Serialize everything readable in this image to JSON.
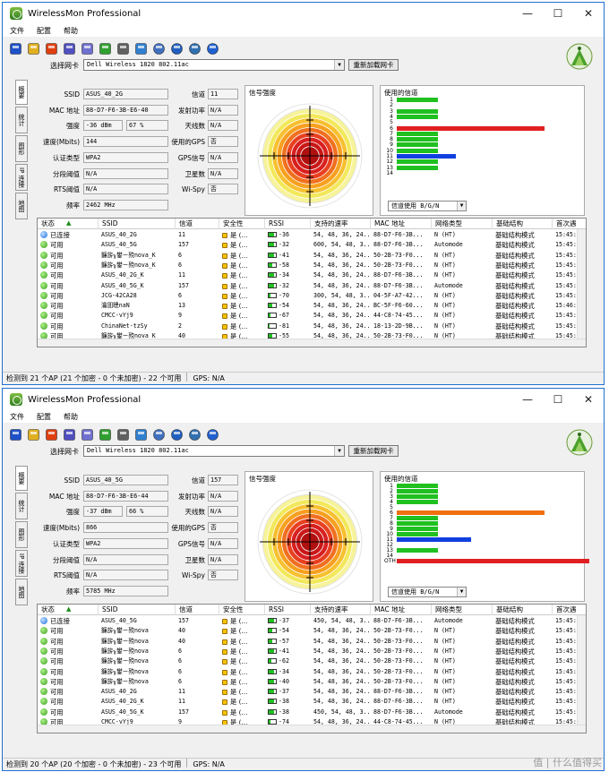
{
  "windows": [
    {
      "title": "WirelessMon Professional",
      "menu": [
        "文件",
        "配置",
        "帮助"
      ],
      "adapter_label": "选择网卡",
      "adapter_value": "Dell Wireless 1820 802.11ac",
      "reload_label": "重新加载网卡",
      "tabs": [
        "概要",
        "统计",
        "图形",
        "IP 连接",
        "地图"
      ],
      "info_left": [
        {
          "label": "SSID",
          "value": "ASUS_40_2G"
        },
        {
          "label": "MAC 地址",
          "value": "88-D7-F6-3B-E6-40"
        },
        {
          "label": "强度",
          "value": "-36  dBm",
          "value2": "67 %"
        },
        {
          "label": "速度(Mbits)",
          "value": "144"
        },
        {
          "label": "认证类型",
          "value": "WPA2"
        },
        {
          "label": "分段阈值",
          "value": "N/A"
        },
        {
          "label": "RTS阈值",
          "value": "N/A"
        },
        {
          "label": "频率",
          "value": "2462 MHz"
        }
      ],
      "info_right": [
        {
          "label": "信道",
          "value": "11"
        },
        {
          "label": "发射功率",
          "value": "N/A"
        },
        {
          "label": "天线数",
          "value": "N/A"
        },
        {
          "label": "使用的GPS",
          "value": "否"
        },
        {
          "label": "GPS信号",
          "value": "N/A"
        },
        {
          "label": "卫星数",
          "value": "N/A"
        },
        {
          "label": "Wi-Spy",
          "value": "否"
        }
      ],
      "signal_title": "信号强度",
      "channel_title": "使用的信道",
      "channels": [
        {
          "ch": "1",
          "level": 0.28,
          "color": "#20c020"
        },
        {
          "ch": "2",
          "level": 0.0,
          "color": "#20c020"
        },
        {
          "ch": "3",
          "level": 0.28,
          "color": "#20c020"
        },
        {
          "ch": "4",
          "level": 0.28,
          "color": "#20c020"
        },
        {
          "ch": "5",
          "level": 0.0,
          "color": "#20c020"
        },
        {
          "ch": "6",
          "level": 1.0,
          "color": "#e02020"
        },
        {
          "ch": "7",
          "level": 0.28,
          "color": "#20c020"
        },
        {
          "ch": "8",
          "level": 0.28,
          "color": "#20c020"
        },
        {
          "ch": "9",
          "level": 0.28,
          "color": "#20c020"
        },
        {
          "ch": "10",
          "level": 0.28,
          "color": "#20c020"
        },
        {
          "ch": "11",
          "level": 0.4,
          "color": "#1040e0"
        },
        {
          "ch": "12",
          "level": 0.28,
          "color": "#20c020"
        },
        {
          "ch": "13",
          "level": 0.28,
          "color": "#20c020"
        },
        {
          "ch": "14",
          "level": 0.0,
          "color": "#20c020"
        }
      ],
      "channel_select": "信道使用 B/G/N",
      "columns": [
        "状态",
        "SSID",
        "信道",
        "安全性",
        "RSSI",
        "支持的速率",
        "MAC 地址",
        "网络类型",
        "基础结构",
        "首次遇"
      ],
      "rows": [
        {
          "status": "已连接",
          "ssid": "ASUS_40_2G",
          "ch": "11",
          "sec": "是 (...",
          "rssi": "-36",
          "bar": 0.8,
          "rates": "54, 48, 36, 24...",
          "mac": "88-D7-F6-3B...",
          "net": "N (HT)",
          "infra": "基础结构模式",
          "first": "15:45:"
        },
        {
          "status": "可用",
          "ssid": "ASUS_40_5G",
          "ch": "157",
          "sec": "是 (...",
          "rssi": "-32",
          "bar": 0.8,
          "rates": "600, 54, 48, 3...",
          "mac": "88-D7-F6-3B...",
          "net": "Automode",
          "infra": "基础结构模式",
          "first": "15:45:"
        },
        {
          "status": "可用",
          "ssid": "鐮旂┒鐢ㄧ殑nova_K",
          "ch": "6",
          "sec": "是 (...",
          "rssi": "-41",
          "bar": 0.7,
          "rates": "54, 48, 36, 24...",
          "mac": "50-2B-73-F0...",
          "net": "N (HT)",
          "infra": "基础结构模式",
          "first": "15:45:"
        },
        {
          "status": "可用",
          "ssid": "鐮旂┒鐢ㄧ殑nova_K",
          "ch": "6",
          "sec": "是 (...",
          "rssi": "-58",
          "bar": 0.45,
          "rates": "54, 48, 36, 24...",
          "mac": "50-2B-73-F0...",
          "net": "N (HT)",
          "infra": "基础结构模式",
          "first": "15:45:"
        },
        {
          "status": "可用",
          "ssid": "ASUS_40_2G_K",
          "ch": "11",
          "sec": "是 (...",
          "rssi": "-34",
          "bar": 0.8,
          "rates": "54, 48, 36, 24...",
          "mac": "88-D7-F6-3B...",
          "net": "N (HT)",
          "infra": "基础结构模式",
          "first": "15:45:"
        },
        {
          "status": "可用",
          "ssid": "ASUS_40_5G_K",
          "ch": "157",
          "sec": "是 (...",
          "rssi": "-32",
          "bar": 0.8,
          "rates": "54, 48, 36, 24...",
          "mac": "88-D7-F6-3B...",
          "net": "Automode",
          "infra": "基础结构模式",
          "first": "15:45:"
        },
        {
          "status": "可用",
          "ssid": "JCG-42CA28",
          "ch": "6",
          "sec": "是 (...",
          "rssi": "-70",
          "bar": 0.2,
          "rates": "300, 54, 48, 3...",
          "mac": "04-5F-A7-42...",
          "net": "N (HT)",
          "infra": "基础结构模式",
          "first": "15:45:"
        },
        {
          "status": "可用",
          "ssid": "瀹囬瞣naN",
          "ch": "13",
          "sec": "是 (...",
          "rssi": "-54",
          "bar": 0.55,
          "rates": "54, 48, 36, 24...",
          "mac": "BC-5F-F6-60...",
          "net": "N (HT)",
          "infra": "基础结构模式",
          "first": "15:46:"
        },
        {
          "status": "可用",
          "ssid": "CMCC-vYj9",
          "ch": "9",
          "sec": "是 (...",
          "rssi": "-67",
          "bar": 0.3,
          "rates": "54, 48, 36, 24...",
          "mac": "44-C8-74-45...",
          "net": "N (HT)",
          "infra": "基础结构模式",
          "first": "15:45:"
        },
        {
          "status": "可用",
          "ssid": "ChinaNet-tzSy",
          "ch": "2",
          "sec": "是 (...",
          "rssi": "-81",
          "bar": 0.1,
          "rates": "54, 48, 36, 24...",
          "mac": "18-13-2D-9B...",
          "net": "N (HT)",
          "infra": "基础结构模式",
          "first": "15:45:"
        },
        {
          "status": "可用",
          "ssid": "鐮旂┒鐢ㄧ殑nova_K",
          "ch": "40",
          "sec": "是 (...",
          "rssi": "-55",
          "bar": 0.55,
          "rates": "54, 48, 36, 24...",
          "mac": "50-2B-73-F0...",
          "net": "N (HT)",
          "infra": "基础结构模式",
          "first": "15:45:"
        }
      ],
      "status": {
        "detected": "检测到 21 个AP (21 个加密 - 0 个未加密) - 22 个可用",
        "gps": "GPS: N/A"
      }
    },
    {
      "title": "WirelessMon Professional",
      "menu": [
        "文件",
        "配置",
        "帮助"
      ],
      "adapter_label": "选择网卡",
      "adapter_value": "Dell Wireless 1820 802.11ac",
      "reload_label": "重新加载网卡",
      "tabs": [
        "概要",
        "统计",
        "图形",
        "IP 连接",
        "地图"
      ],
      "info_left": [
        {
          "label": "SSID",
          "value": "ASUS_40_5G"
        },
        {
          "label": "MAC 地址",
          "value": "88-D7-F6-3B-E6-44"
        },
        {
          "label": "强度",
          "value": "-37  dBm",
          "value2": "66 %"
        },
        {
          "label": "速度(Mbits)",
          "value": "866"
        },
        {
          "label": "认证类型",
          "value": "WPA2"
        },
        {
          "label": "分段阈值",
          "value": "N/A"
        },
        {
          "label": "RTS阈值",
          "value": "N/A"
        },
        {
          "label": "频率",
          "value": "5785 MHz"
        }
      ],
      "info_right": [
        {
          "label": "信道",
          "value": "157"
        },
        {
          "label": "发射功率",
          "value": "N/A"
        },
        {
          "label": "天线数",
          "value": "N/A"
        },
        {
          "label": "使用的GPS",
          "value": "否"
        },
        {
          "label": "GPS信号",
          "value": "N/A"
        },
        {
          "label": "卫星数",
          "value": "N/A"
        },
        {
          "label": "Wi-Spy",
          "value": "否"
        }
      ],
      "signal_title": "信号强度",
      "channel_title": "使用的信道",
      "channels": [
        {
          "ch": "1",
          "level": 0.28,
          "color": "#20c020"
        },
        {
          "ch": "2",
          "level": 0.28,
          "color": "#20c020"
        },
        {
          "ch": "3",
          "level": 0.28,
          "color": "#20c020"
        },
        {
          "ch": "4",
          "level": 0.28,
          "color": "#20c020"
        },
        {
          "ch": "5",
          "level": 0.0,
          "color": "#20c020"
        },
        {
          "ch": "6",
          "level": 1.0,
          "color": "#f07010"
        },
        {
          "ch": "7",
          "level": 0.28,
          "color": "#20c020"
        },
        {
          "ch": "8",
          "level": 0.28,
          "color": "#20c020"
        },
        {
          "ch": "9",
          "level": 0.28,
          "color": "#20c020"
        },
        {
          "ch": "10",
          "level": 0.28,
          "color": "#20c020"
        },
        {
          "ch": "11",
          "level": 0.5,
          "color": "#1040e0"
        },
        {
          "ch": "12",
          "level": 0.0,
          "color": "#20c020"
        },
        {
          "ch": "13",
          "level": 0.28,
          "color": "#20c020"
        },
        {
          "ch": "14",
          "level": 0.0,
          "color": "#20c020"
        },
        {
          "ch": "OTH",
          "level": 1.6,
          "color": "#e02020"
        }
      ],
      "channel_select": "信道使用 B/G/N",
      "columns": [
        "状态",
        "SSID",
        "信道",
        "安全性",
        "RSSI",
        "支持的速率",
        "MAC 地址",
        "网络类型",
        "基础结构",
        "首次遇"
      ],
      "rows": [
        {
          "status": "已连接",
          "ssid": "ASUS_40_5G",
          "ch": "157",
          "sec": "是 (...",
          "rssi": "-37",
          "bar": 0.8,
          "rates": "450, 54, 48, 3...",
          "mac": "88-D7-F6-3B...",
          "net": "Automode",
          "infra": "基础结构模式",
          "first": "15:45:"
        },
        {
          "status": "可用",
          "ssid": "鐮旂┒鐢ㄧ殑nova",
          "ch": "40",
          "sec": "是 (...",
          "rssi": "-54",
          "bar": 0.55,
          "rates": "54, 48, 36, 24...",
          "mac": "50-2B-73-F0...",
          "net": "N (HT)",
          "infra": "基础结构模式",
          "first": "15:45:"
        },
        {
          "status": "可用",
          "ssid": "鐮旂┒鐢ㄧ殑nova",
          "ch": "40",
          "sec": "是 (...",
          "rssi": "-57",
          "bar": 0.5,
          "rates": "54, 48, 36, 24...",
          "mac": "50-2B-73-F0...",
          "net": "N (HT)",
          "infra": "基础结构模式",
          "first": "15:45:"
        },
        {
          "status": "可用",
          "ssid": "鐮旂┒鐢ㄧ殑nova",
          "ch": "6",
          "sec": "是 (...",
          "rssi": "-41",
          "bar": 0.7,
          "rates": "54, 48, 36, 24...",
          "mac": "50-2B-73-F0...",
          "net": "N (HT)",
          "infra": "基础结构模式",
          "first": "15:45:"
        },
        {
          "status": "可用",
          "ssid": "鐮旂┒鐢ㄧ殑nova",
          "ch": "6",
          "sec": "是 (...",
          "rssi": "-62",
          "bar": 0.4,
          "rates": "54, 48, 36, 24...",
          "mac": "50-2B-73-F0...",
          "net": "N (HT)",
          "infra": "基础结构模式",
          "first": "15:45:"
        },
        {
          "status": "可用",
          "ssid": "鐮旂┒鐢ㄧ殑nova",
          "ch": "6",
          "sec": "是 (...",
          "rssi": "-34",
          "bar": 0.8,
          "rates": "54, 48, 36, 24...",
          "mac": "50-2B-73-F0...",
          "net": "N (HT)",
          "infra": "基础结构模式",
          "first": "15:45:"
        },
        {
          "status": "可用",
          "ssid": "鐮旂┒鐢ㄧ殑nova",
          "ch": "6",
          "sec": "是 (...",
          "rssi": "-40",
          "bar": 0.7,
          "rates": "54, 48, 36, 24...",
          "mac": "50-2B-73-F0...",
          "net": "N (HT)",
          "infra": "基础结构模式",
          "first": "15:45:"
        },
        {
          "status": "可用",
          "ssid": "ASUS_40_2G",
          "ch": "11",
          "sec": "是 (...",
          "rssi": "-37",
          "bar": 0.8,
          "rates": "54, 48, 36, 24...",
          "mac": "88-D7-F6-3B...",
          "net": "N (HT)",
          "infra": "基础结构模式",
          "first": "15:45:"
        },
        {
          "status": "可用",
          "ssid": "ASUS_40_2G_K",
          "ch": "11",
          "sec": "是 (...",
          "rssi": "-38",
          "bar": 0.8,
          "rates": "54, 48, 36, 24...",
          "mac": "88-D7-F6-3B...",
          "net": "N (HT)",
          "infra": "基础结构模式",
          "first": "15:45:"
        },
        {
          "status": "可用",
          "ssid": "ASUS_40_5G_K",
          "ch": "157",
          "sec": "是 (...",
          "rssi": "-38",
          "bar": 0.8,
          "rates": "450, 54, 48, 3...",
          "mac": "88-D7-F6-3B...",
          "net": "Automode",
          "infra": "基础结构模式",
          "first": "15:45:"
        },
        {
          "status": "可用",
          "ssid": "CMCC-vYj9",
          "ch": "9",
          "sec": "是 (...",
          "rssi": "-74",
          "bar": 0.2,
          "rates": "54, 48, 36, 24...",
          "mac": "44-C8-74-45...",
          "net": "N (HT)",
          "infra": "基础结构模式",
          "first": "15:45:"
        }
      ],
      "status": {
        "detected": "检测到 20 个AP (20 个加密 - 0 个未加密) - 23 个可用",
        "gps": "GPS: N/A"
      }
    }
  ],
  "watermark": "值 | 什么值得买"
}
